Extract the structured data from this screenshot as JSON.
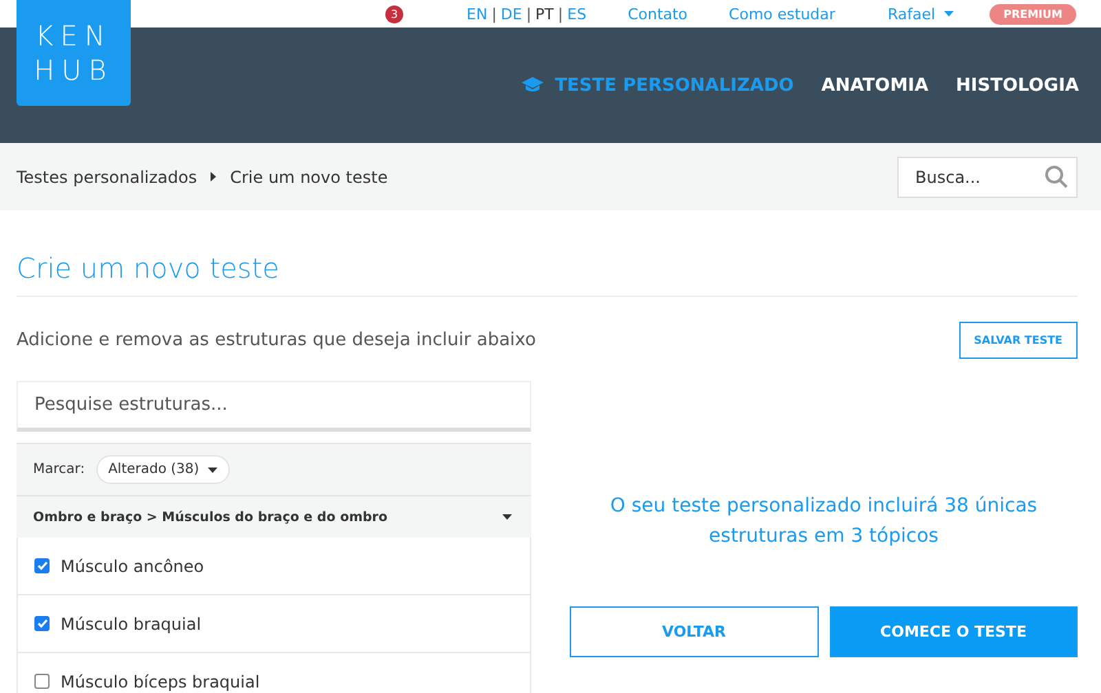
{
  "logo": {
    "line_1": "KEN",
    "line_2": "HUB"
  },
  "top_bar": {
    "notifications": "3",
    "languages": [
      {
        "label": "EN",
        "selected": false
      },
      {
        "label": "DE",
        "selected": false
      },
      {
        "label": "PT",
        "selected": true
      },
      {
        "label": "ES",
        "selected": false
      }
    ],
    "language_separator": "|",
    "links": [
      "Contato",
      "Como estudar"
    ],
    "user": "Rafael",
    "premium": "PREMIUM"
  },
  "nav": [
    {
      "label": "TESTE PERSONALIZADO",
      "selected": true
    },
    {
      "label": "ANATOMIA",
      "selected": false
    },
    {
      "label": "HISTOLOGIA",
      "selected": false
    }
  ],
  "breadcrumb": [
    "Testes personalizados",
    "Crie um novo teste"
  ],
  "search": {
    "placeholder": "Busca..."
  },
  "title": "Crie um novo teste",
  "subtitle": "Adicione e remova as estruturas que deseja incluir abaixo",
  "save_button": "SALVAR TESTE",
  "structure_search": {
    "placeholder": "Pesquise estruturas..."
  },
  "mark": {
    "label": "Marcar:",
    "value": "Alterado (38)"
  },
  "group": "Ombro e braço > Músculos do braço e do ombro",
  "items": [
    {
      "label": "Músculo ancôneo",
      "checked": true
    },
    {
      "label": "Músculo braquial",
      "checked": true
    },
    {
      "label": "Músculo bíceps braquial",
      "checked": false
    }
  ],
  "summary": "O seu teste personalizado incluirá 38 únicas estruturas em 3 tópicos",
  "buttons": {
    "back": "VOLTAR",
    "start": "COMECE O TESTE"
  }
}
